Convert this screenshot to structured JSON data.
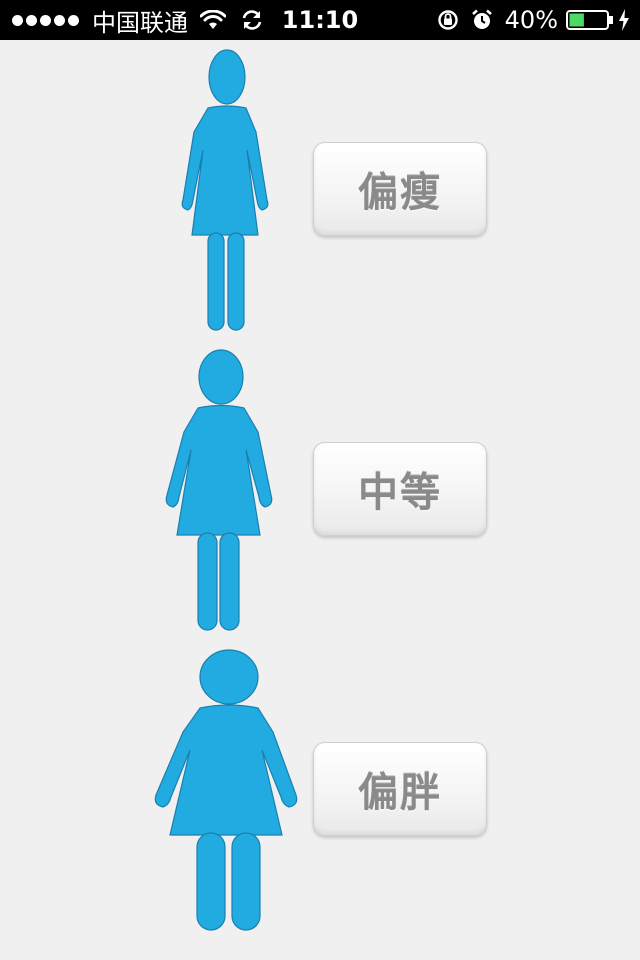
{
  "status_bar": {
    "carrier": "中国联通",
    "time": "11:10",
    "battery_percent": "40%",
    "battery_level": 0.4,
    "icons": [
      "signal-dots",
      "wifi-icon",
      "sync-icon",
      "rotation-lock-icon",
      "alarm-icon",
      "battery-icon",
      "charging-bolt-icon"
    ]
  },
  "options": [
    {
      "label": "偏瘦",
      "figure_icon": "woman-thin-icon"
    },
    {
      "label": "中等",
      "figure_icon": "woman-medium-icon"
    },
    {
      "label": "偏胖",
      "figure_icon": "woman-heavy-icon"
    }
  ],
  "colors": {
    "figure": "#22abe1",
    "background": "#f0f0f0",
    "button_text": "#8a8a8a",
    "battery_fill": "#4cd964"
  }
}
